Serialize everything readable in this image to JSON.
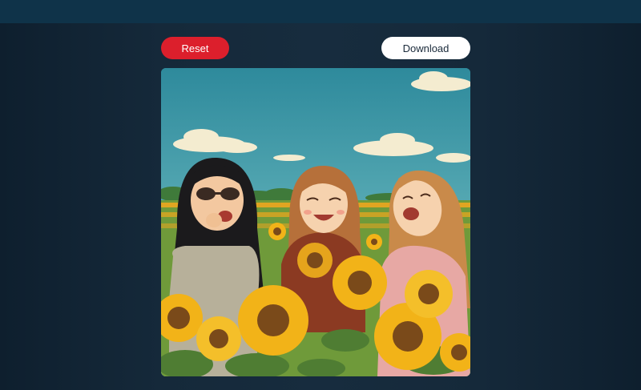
{
  "toolbar": {
    "reset_label": "Reset",
    "download_label": "Download"
  },
  "image": {
    "icon": "illustration-image",
    "colors": {
      "sky_top": "#2e8a9c",
      "sky_bottom": "#7cc2c4",
      "sunflower": "#f2b318",
      "leaf": "#4f7d33",
      "reset": "#dc1f2c"
    }
  }
}
